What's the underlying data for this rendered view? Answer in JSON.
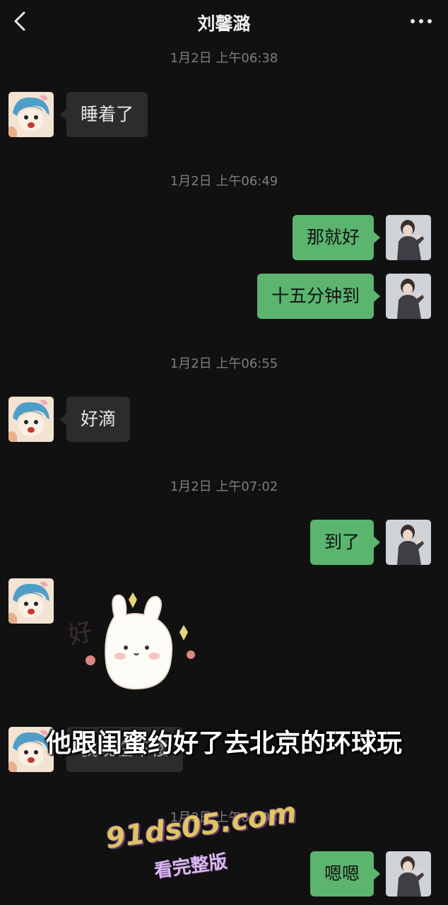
{
  "header": {
    "title": "刘馨潞"
  },
  "messages": [
    {
      "time": "1月2日 上午06:38"
    },
    {
      "in_1": "睡着了"
    },
    {
      "time": "1月2日 上午06:49"
    }
  ],
  "times": [
    "1月2日 上午06:38",
    "1月2日 上午06:49",
    "1月2日 上午06:55",
    "1月2日 上午07:02",
    "1月2日 上午07:05"
  ],
  "bubbles": {
    "in_1": "睡着了",
    "out_1": "那就好",
    "out_2": "十五分钟到",
    "in_2": "好滴",
    "out_3": "到了",
    "in_3_partial": "我现在下楼",
    "out_4": "嗯嗯"
  },
  "sticker_text": "好",
  "caption": "他跟闺蜜约好了去北京的环球玩",
  "watermark": {
    "url": "91ds05.com",
    "sub": "看完整版"
  },
  "colors": {
    "background": "#111111",
    "incoming_bubble": "#2c2c2c",
    "outgoing_bubble": "#5bb56f",
    "timestamp": "#7e7e7e"
  }
}
